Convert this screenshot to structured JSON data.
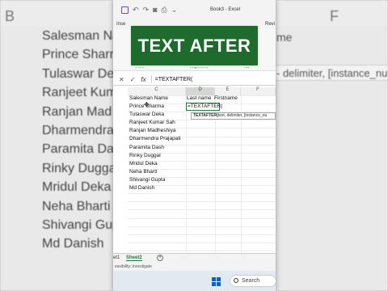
{
  "background": {
    "col_left": "B",
    "col_right": "F",
    "rows": [
      "Salesman Na",
      "Prince Sharm",
      "Tulaswar De",
      "Ranjeet Kum",
      "Ranjan Mad",
      "Dharmendra",
      "Paramita Da",
      "Rinky Dugga",
      "Mridul Deka",
      "Neha Bharti",
      "Shivangi Gup",
      "Md Danish"
    ],
    "right_top": "me",
    "right_formula": "- delimiter, [instance_nu"
  },
  "window": {
    "title": "Book3 - Excel",
    "tabs": [
      "Inse",
      "Revi"
    ],
    "ribbon_labels": [
      "Font",
      "Alignment",
      "Nu"
    ]
  },
  "banner": {
    "text": "TEXT AFTER"
  },
  "formula_bar": {
    "cancel": "✕",
    "confirm": "✓",
    "fx": "fx",
    "formula": "=TEXTAFTER("
  },
  "columns": [
    "C",
    "D",
    "E",
    "F"
  ],
  "headers": {
    "c": "Salesman Name",
    "d": "Last name",
    "e": "Firstname"
  },
  "names": [
    "Prince Sharma",
    "Tulaswar Deka",
    "Ranjeet Kumar Sah",
    "Ranjan Madheshiya",
    "Dharmendra Prajapati",
    "Paramita Dash",
    "Rinky Duggal",
    "Mridul Deka",
    "Neha Bharti",
    "Shivangi Gupta",
    "Md Danish"
  ],
  "active_cell": "=TEXTAFTER(",
  "tooltip": {
    "fn": "TEXTAFTER(",
    "args": "text, delimiter, [instance_nu"
  },
  "sheets": [
    "et1",
    "Sheet2"
  ],
  "status": "essibility: Investigate",
  "taskbar": {
    "search": "Search"
  },
  "colors": {
    "excel_green": "#1e7a3a",
    "banner_bg": "#1f6b2e"
  }
}
